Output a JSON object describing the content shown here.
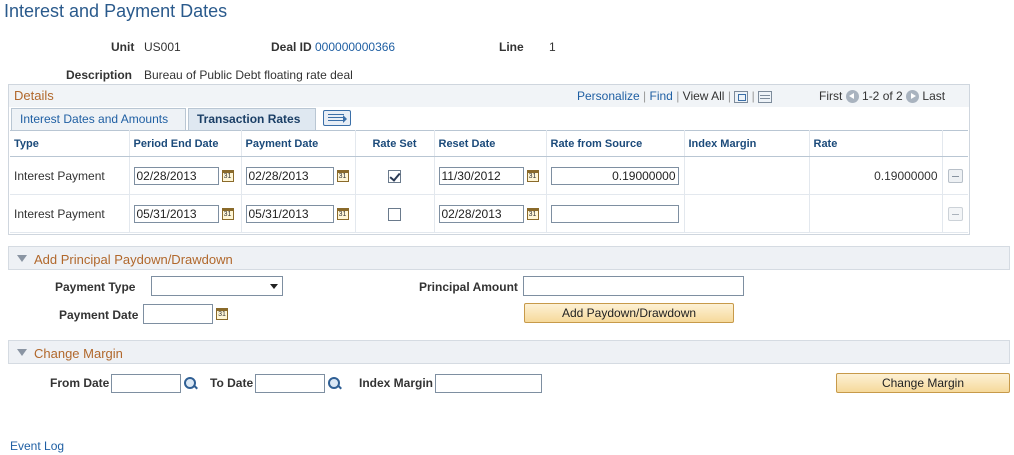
{
  "page": {
    "title": "Interest and Payment Dates"
  },
  "header": {
    "unit_label": "Unit",
    "unit_value": "US001",
    "deal_label": "Deal ID",
    "deal_value": "000000000366",
    "line_label": "Line",
    "line_value": "1",
    "desc_label": "Description",
    "desc_value": "Bureau of Public Debt floating rate deal"
  },
  "grid": {
    "title": "Details",
    "personalize": "Personalize",
    "find": "Find",
    "view_all": "View All",
    "first": "First",
    "range": "1-2 of 2",
    "last": "Last",
    "tabs": [
      {
        "label": "Interest Dates and Amounts",
        "active": false
      },
      {
        "label": "Transaction Rates",
        "active": true
      }
    ],
    "columns": [
      "Type",
      "Period End Date",
      "Payment Date",
      "Rate Set",
      "Reset Date",
      "Rate from Source",
      "Index Margin",
      "Rate"
    ],
    "rows": [
      {
        "type": "Interest Payment",
        "period_end": "02/28/2013",
        "payment_date": "02/28/2013",
        "rate_set": true,
        "reset_date": "11/30/2012",
        "rate_source": "0.19000000",
        "index_margin": "",
        "rate": "0.19000000"
      },
      {
        "type": "Interest Payment",
        "period_end": "05/31/2013",
        "payment_date": "05/31/2013",
        "rate_set": false,
        "reset_date": "02/28/2013",
        "rate_source": "",
        "index_margin": "",
        "rate": ""
      }
    ]
  },
  "paydown": {
    "section_title": "Add Principal Paydown/Drawdown",
    "payment_type_label": "Payment Type",
    "payment_type_value": "",
    "principal_amount_label": "Principal Amount",
    "principal_amount_value": "",
    "payment_date_label": "Payment Date",
    "payment_date_value": "",
    "button": "Add Paydown/Drawdown"
  },
  "margin": {
    "section_title": "Change Margin",
    "from_date_label": "From Date",
    "from_date_value": "",
    "to_date_label": "To Date",
    "to_date_value": "",
    "index_margin_label": "Index Margin",
    "index_margin_value": "",
    "button": "Change Margin"
  },
  "footer": {
    "event_log": "Event Log"
  }
}
